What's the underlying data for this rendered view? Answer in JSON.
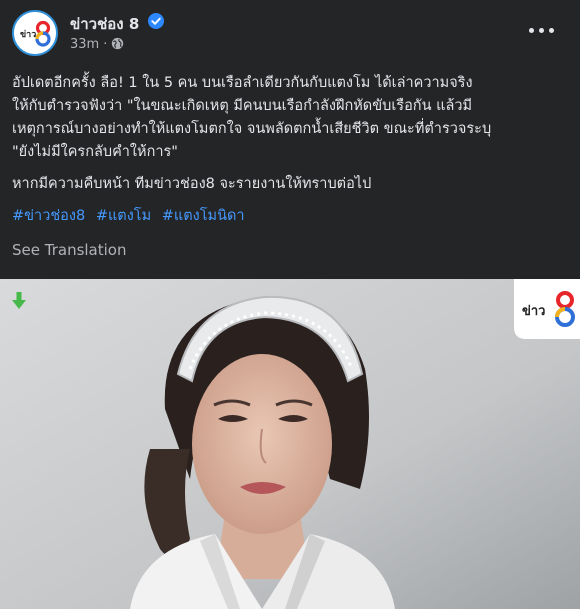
{
  "header": {
    "page_name": "ข่าวช่อง 8",
    "time": "33m",
    "dot": "·",
    "logo_text": "ข่าว8"
  },
  "caption": {
    "line1": "อัปเดตอีกครั้ง ลือ!  1  ใน 5 คน บนเรือลำเดียวกันกับแตงโม ได้เล่าความจริง",
    "line2": "ให้กับตำรวจฟังว่า \"ในขณะเกิดเหตุ มีคนบนเรือกำลังฝึกหัดขับเรือกัน แล้วมี",
    "line3": "เหตุการณ์บางอย่างทำให้แตงโมตกใจ จนพลัดตกน้ำเสียชีวิต ขณะที่ตำรวจระบุ",
    "line4": "\"ยังไม่มีใครกลับคำให้การ\"",
    "paragraph2": "หากมีความคืบหน้า ทีมข่าวช่อง8 จะรายงานให้ทราบต่อไป",
    "hashtags": [
      "#ข่าวช่อง8",
      "#แตงโม",
      "#แตงโมนิดา"
    ]
  },
  "see_translation": "See Translation",
  "photo": {
    "badge_text": "ข่าว8"
  },
  "colors": {
    "background": "#242526",
    "text": "#e4e6eb",
    "secondary_text": "#b0b3b8",
    "link": "#4599ff",
    "verified": "#2d88ff",
    "download_arrow": "#47b94a"
  },
  "icons": {
    "verified": "verified-badge-icon",
    "audience": "globe-icon",
    "more": "more-options-icon",
    "download": "download-arrow-icon"
  }
}
